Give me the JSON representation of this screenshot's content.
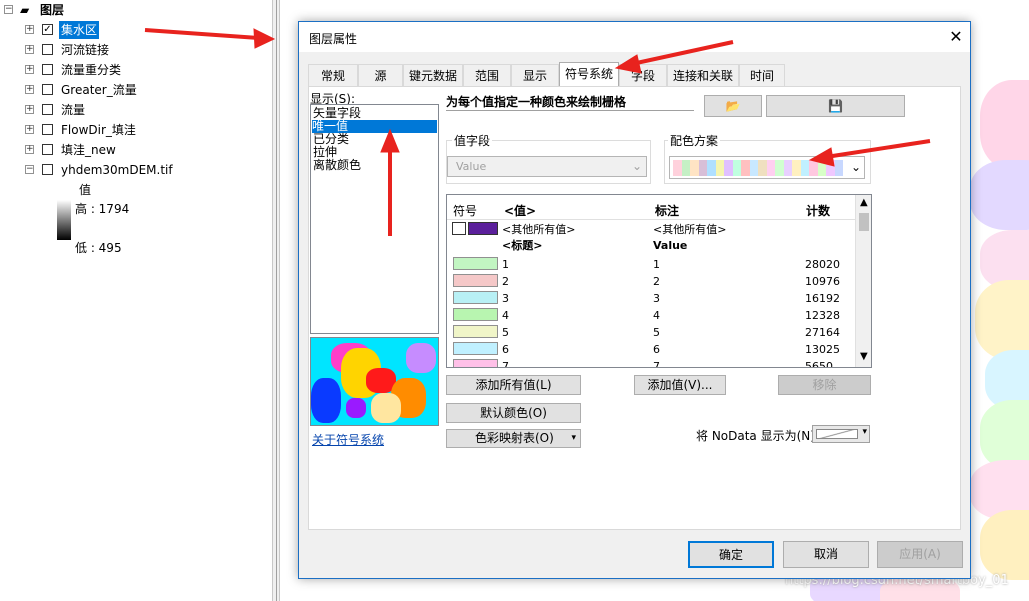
{
  "toc": {
    "root_label": "图层",
    "layers": [
      {
        "label": "集水区",
        "checked": true,
        "selected": true
      },
      {
        "label": "河流链接",
        "checked": false
      },
      {
        "label": "流量重分类",
        "checked": false
      },
      {
        "label": "Greater_流量",
        "checked": false
      },
      {
        "label": "流量",
        "checked": false
      },
      {
        "label": "FlowDir_填洼",
        "checked": false
      },
      {
        "label": "填洼_new",
        "checked": false
      },
      {
        "label": "yhdem30mDEM.tif",
        "checked": false
      }
    ],
    "legend_title": "值",
    "legend_high": "高 : 1794",
    "legend_low": "低 : 495"
  },
  "dialog": {
    "title": "图层属性",
    "close_glyph": "✕",
    "tabs": [
      "常规",
      "源",
      "键元数据",
      "范围",
      "显示",
      "符号系统",
      "字段",
      "连接和关联",
      "时间"
    ],
    "active_tab": "符号系统",
    "show_label": "显示(S):",
    "show_options": [
      "矢量字段",
      "唯一值",
      "已分类",
      "拉伸",
      "离散颜色"
    ],
    "selected_option": "唯一值",
    "description": "为每个值指定一种颜色来绘制栅格",
    "about_link": "关于符号系统",
    "value_field_label": "值字段",
    "value_field_value": "Value",
    "color_scheme_label": "配色方案",
    "scheme_colors": [
      "#ffd1dc",
      "#c5f0c5",
      "#ffe4c4",
      "#d8bfd8",
      "#b0e0ff",
      "#f5f5b0",
      "#e0c0ff",
      "#c0ffe0",
      "#ffc0c0",
      "#c8e8ff",
      "#f0e0c0",
      "#ffd0f0",
      "#d0ffd0",
      "#e8d0ff",
      "#fff0c0",
      "#c0f0ff",
      "#ffc8e0",
      "#d8ffc8",
      "#f0c8ff",
      "#c8d8ff"
    ],
    "grid": {
      "headers": {
        "symbol": "符号",
        "value": "<值>",
        "label": "标注",
        "count": "计数"
      },
      "other_values": "<其他所有值>",
      "other_values_label": "<其他所有值>",
      "heading_value": "<标题>",
      "heading_label": "Value",
      "rows": [
        {
          "color": "#c2f5c2",
          "value": "1",
          "label": "1",
          "count": "28020"
        },
        {
          "color": "#f5c8c8",
          "value": "2",
          "label": "2",
          "count": "10976"
        },
        {
          "color": "#b8f0f5",
          "value": "3",
          "label": "3",
          "count": "16192"
        },
        {
          "color": "#b8f5b0",
          "value": "4",
          "label": "4",
          "count": "12328"
        },
        {
          "color": "#f0f5c8",
          "value": "5",
          "label": "5",
          "count": "27164"
        },
        {
          "color": "#c0f0ff",
          "value": "6",
          "label": "6",
          "count": "13025"
        },
        {
          "color": "#ffc0e8",
          "value": "7",
          "label": "7",
          "count": "5650"
        }
      ]
    },
    "buttons": {
      "add_all": "添加所有值(L)",
      "add_values": "添加值(V)...",
      "remove": "移除",
      "default_colors": "默认颜色(O)",
      "colormap": "色彩映射表(O)",
      "nodata_label": "将 NoData 显示为(N)",
      "ok": "确定",
      "cancel": "取消",
      "apply": "应用(A)"
    }
  },
  "watermark": "https://blog.csdn.net/smartboy_01",
  "colors": {
    "accent": "#0078d7",
    "arrow": "#e8231e",
    "selection": "#0078d7"
  }
}
